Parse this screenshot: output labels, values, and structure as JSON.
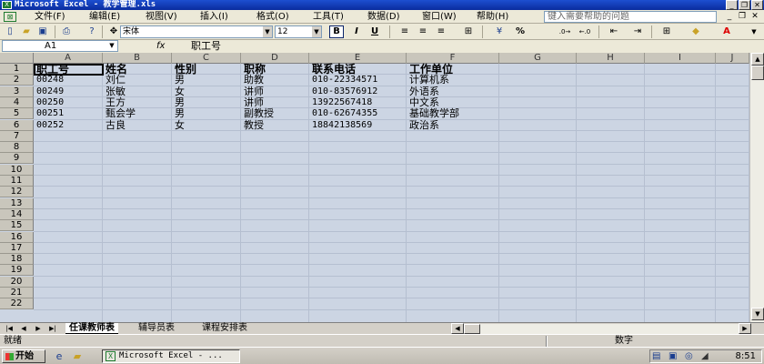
{
  "window": {
    "title": "Microsoft Excel - 教学管理.xls",
    "controls": {
      "minimize": "_",
      "restore": "❐",
      "close": "✕"
    }
  },
  "menu": {
    "items": [
      "文件(F)",
      "编辑(E)",
      "视图(V)",
      "插入(I)",
      "格式(O)",
      "工具(T)",
      "数据(D)",
      "窗口(W)",
      "帮助(H)"
    ],
    "help_placeholder": "键入需要帮助的问题",
    "doc_controls": {
      "minimize": "_",
      "restore": "❐",
      "close": "✕"
    }
  },
  "toolbar": {
    "font_name": "宋体",
    "font_size": "12",
    "bold": "B",
    "italic": "I",
    "underline": "U",
    "percent": "%",
    "currency": "¥"
  },
  "formula_bar": {
    "name_box": "A1",
    "fx": "fx",
    "content": "职工号"
  },
  "sheet": {
    "columns": [
      "A",
      "B",
      "C",
      "D",
      "E",
      "F",
      "G",
      "H",
      "I",
      "J"
    ],
    "rows": [
      "1",
      "2",
      "3",
      "4",
      "5",
      "6",
      "7",
      "8",
      "9",
      "10",
      "11",
      "12",
      "13",
      "14",
      "15",
      "16",
      "17",
      "18",
      "19",
      "20",
      "21",
      "22"
    ],
    "headers": [
      "职工号",
      "姓名",
      "性别",
      "职称",
      "联系电话",
      "工作单位"
    ],
    "records": [
      [
        "00248",
        "刘仁",
        "男",
        "助教",
        "010-22334571",
        "计算机系"
      ],
      [
        "00249",
        "张敏",
        "女",
        "讲师",
        "010-83576912",
        "外语系"
      ],
      [
        "00250",
        "王方",
        "男",
        "讲师",
        "13922567418",
        "中文系"
      ],
      [
        "00251",
        "甄会学",
        "男",
        "副教授",
        "010-62674355",
        "基础教学部"
      ],
      [
        "00252",
        "古良",
        "女",
        "教授",
        "18842138569",
        "政治系"
      ]
    ]
  },
  "tabs": {
    "nav": [
      "|◀",
      "◀",
      "▶",
      "▶|"
    ],
    "sheets": [
      "任课教师表",
      "辅导员表",
      "课程安排表"
    ],
    "active": 0
  },
  "status": {
    "left": "就绪",
    "mode": "数字"
  },
  "taskbar": {
    "start": "开始",
    "task": "Microsoft Excel - ...",
    "clock": "8:51"
  }
}
